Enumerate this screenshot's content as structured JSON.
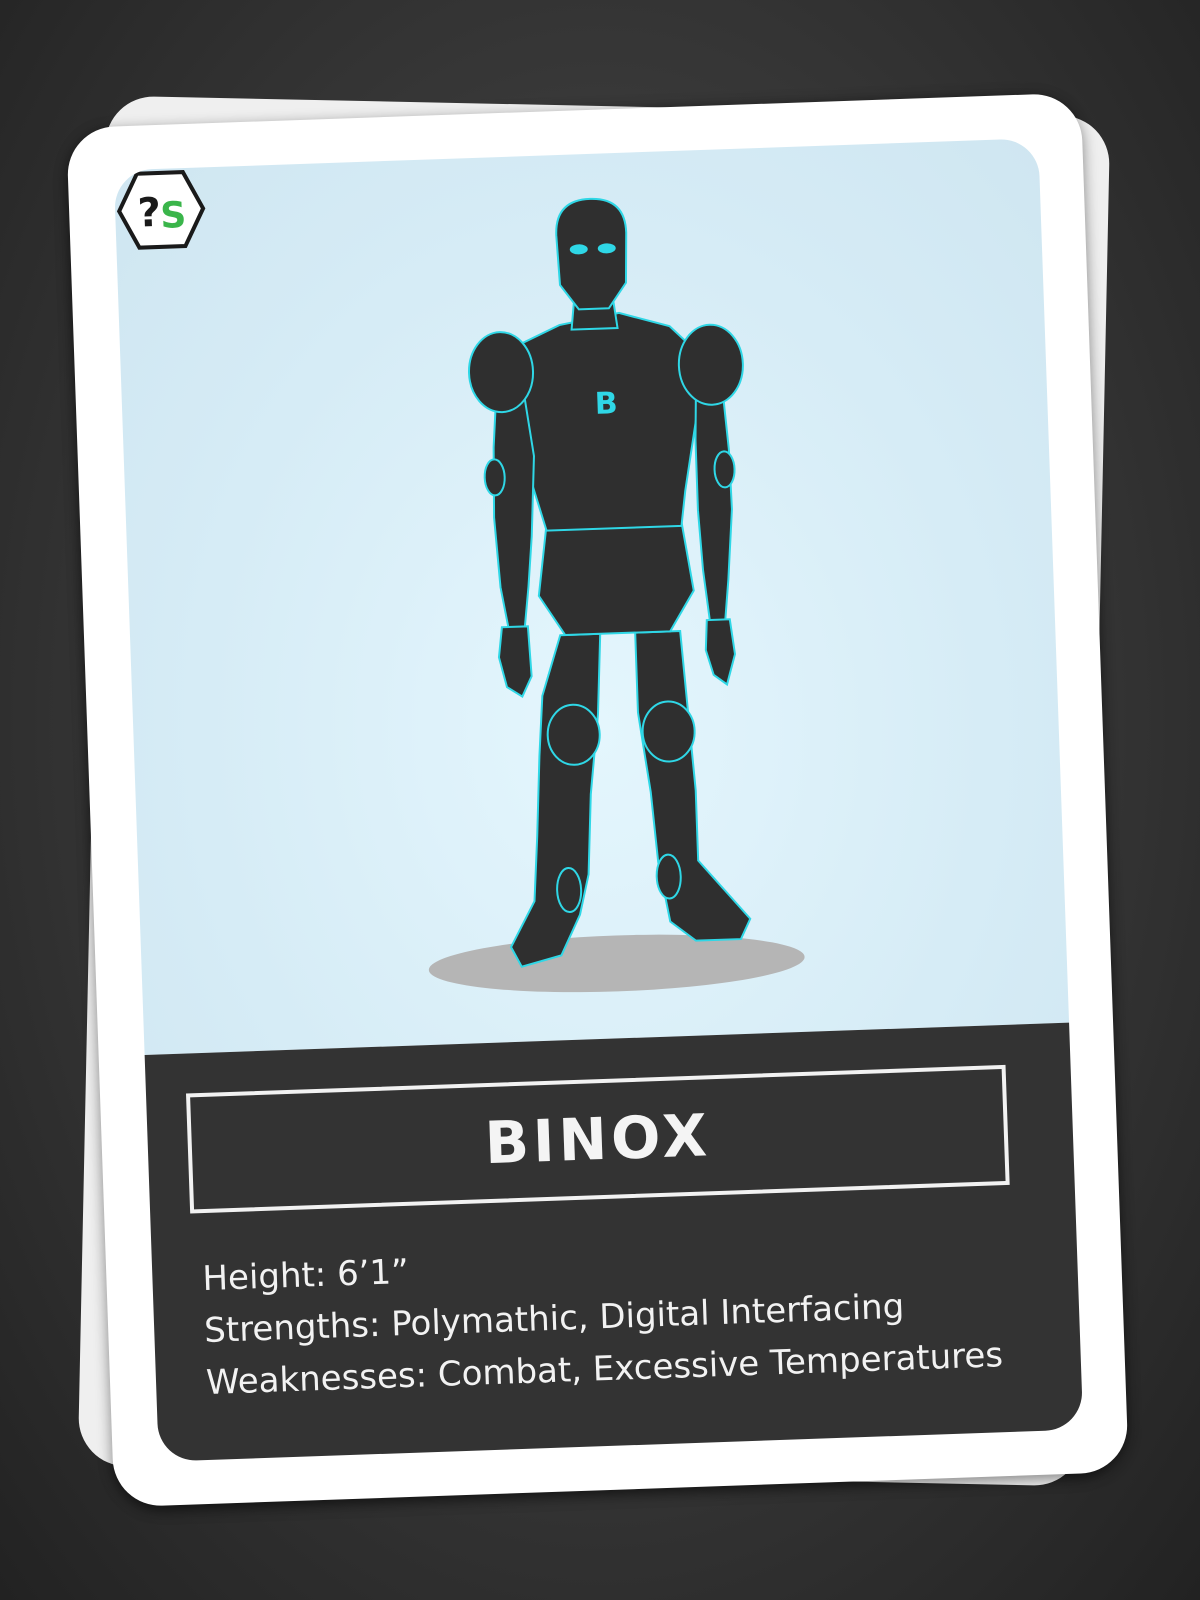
{
  "card": {
    "name": "BINOX",
    "chest_emblem": "B",
    "stats": [
      {
        "label": "Height:",
        "value": "6’1”"
      },
      {
        "label": "Strengths:",
        "value": "Polymathic, Digital Interfacing"
      },
      {
        "label": "Weaknesses:",
        "value": "Combat, Excessive Temperatures"
      }
    ]
  },
  "logo": {
    "text_left": "?",
    "text_right": "S",
    "icon": "ps-hexagon-logo"
  },
  "colors": {
    "accent_cyan": "#2fd7e6",
    "robot_body": "#2f2f2f",
    "art_background": "#d8eef7",
    "info_panel": "#333333",
    "logo_green": "#3ab54a"
  }
}
